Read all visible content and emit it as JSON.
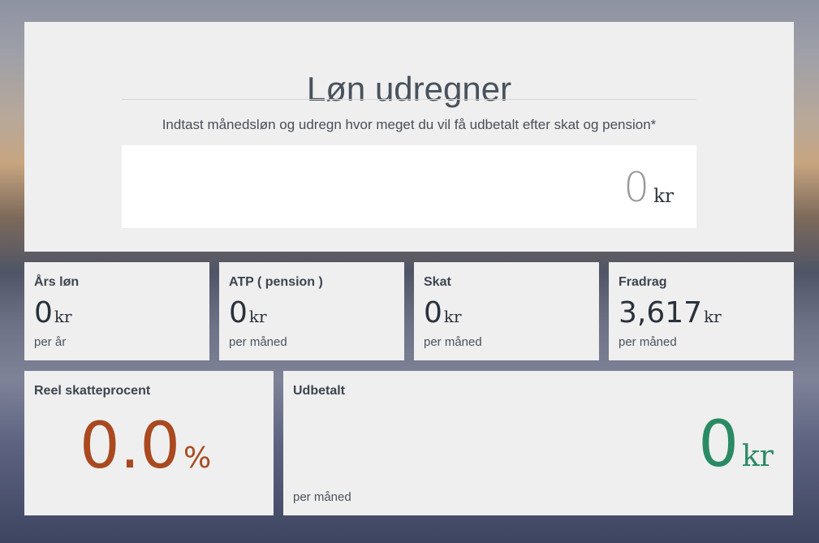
{
  "header": {
    "title": "Løn udregner",
    "instruction": "Indtast månedsløn og udregn hvor meget du vil få udbetalt efter skat og pension*"
  },
  "salary_input": {
    "value": "0",
    "unit": "kr"
  },
  "stats": [
    {
      "label": "Års løn",
      "value": "0",
      "unit": "kr",
      "sub": "per år"
    },
    {
      "label": "ATP ( pension )",
      "value": "0",
      "unit": "kr",
      "sub": "per måned"
    },
    {
      "label": "Skat",
      "value": "0",
      "unit": "kr",
      "sub": "per måned"
    },
    {
      "label": "Fradrag",
      "value": "3,617",
      "unit": "kr",
      "sub": "per måned"
    }
  ],
  "tax_rate": {
    "label": "Reel skatteprocent",
    "value": "0.0",
    "unit": "%",
    "color": "#a9491f"
  },
  "payout": {
    "label": "Udbetalt",
    "value": "0",
    "unit": "kr",
    "sub": "per måned",
    "color": "#2a8a63"
  }
}
